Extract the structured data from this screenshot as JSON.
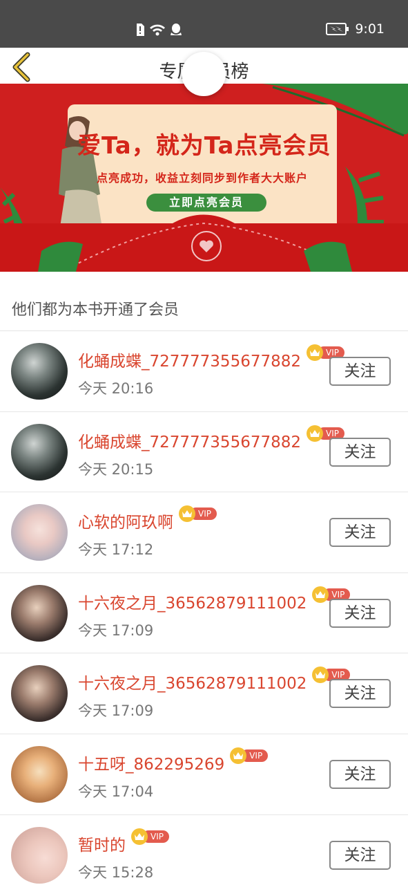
{
  "status_bar": {
    "time": "9:01"
  },
  "header": {
    "title": "专属会员榜"
  },
  "banner": {
    "title": "爱Ta，就为Ta点亮会员",
    "subtitle": "点亮成功，收益立刻同步到作者大大账户",
    "button_label": "立即点亮会员"
  },
  "section": {
    "title": "他们都为本书开通了会员"
  },
  "vip_label": "VIP",
  "colors": {
    "name": "#d9462f",
    "vip": "#e35b4e",
    "banner_bg": "#cf1f1f",
    "banner_button": "#3b8f3e"
  },
  "members": [
    {
      "name": "化蛹成蝶_727777355677882",
      "time": "今天 20:16",
      "follow_label": "关注",
      "avatar": "dark-landscape-avatar"
    },
    {
      "name": "化蛹成蝶_727777355677882",
      "time": "今天 20:15",
      "follow_label": "关注",
      "avatar": "dark-landscape-avatar"
    },
    {
      "name": "心软的阿玖啊",
      "time": "今天 17:12",
      "follow_label": "关注",
      "avatar": "girl-crown-avatar"
    },
    {
      "name": "十六夜之月_36562879111002",
      "time": "今天 17:09",
      "follow_label": "关注",
      "avatar": "girl-selfie-avatar"
    },
    {
      "name": "十六夜之月_36562879111002",
      "time": "今天 17:09",
      "follow_label": "关注",
      "avatar": "girl-selfie-avatar"
    },
    {
      "name": "十五呀_862295269",
      "time": "今天 17:04",
      "follow_label": "关注",
      "avatar": "cartoon-girl-avatar"
    },
    {
      "name": "暂时的",
      "time": "今天 15:28",
      "follow_label": "关注",
      "avatar": "blurred-pink-avatar"
    }
  ]
}
